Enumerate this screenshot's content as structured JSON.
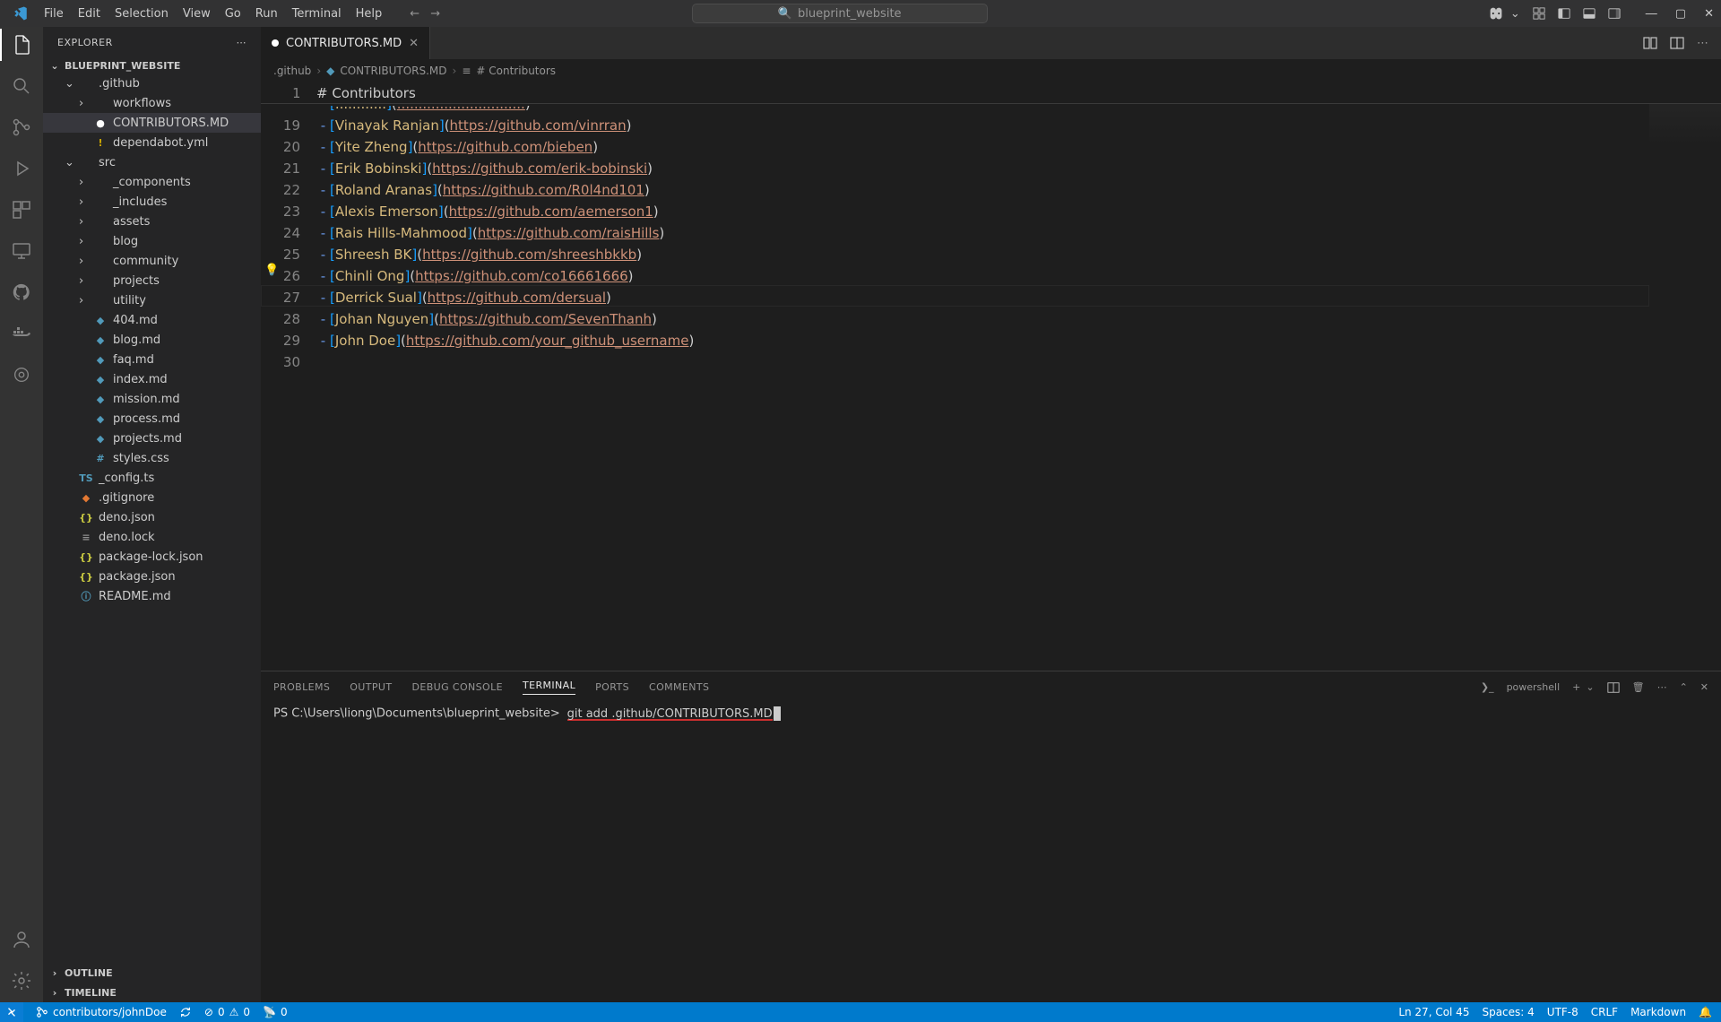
{
  "titlebar": {
    "project": "blueprint_website"
  },
  "menu": [
    "File",
    "Edit",
    "Selection",
    "View",
    "Go",
    "Run",
    "Terminal",
    "Help"
  ],
  "sidebar": {
    "title": "EXPLORER",
    "root": "BLUEPRINT_WEBSITE",
    "items": [
      {
        "label": ".github",
        "kind": "folder",
        "indent": 1,
        "open": true
      },
      {
        "label": "workflows",
        "kind": "folder",
        "indent": 2
      },
      {
        "label": "CONTRIBUTORS.MD",
        "kind": "md",
        "indent": 2,
        "active": true,
        "mod": true
      },
      {
        "label": "dependabot.yml",
        "kind": "yaml",
        "indent": 2,
        "warn": true
      },
      {
        "label": "src",
        "kind": "folder",
        "indent": 1,
        "open": true
      },
      {
        "label": "_components",
        "kind": "folder",
        "indent": 2
      },
      {
        "label": "_includes",
        "kind": "folder",
        "indent": 2
      },
      {
        "label": "assets",
        "kind": "folder",
        "indent": 2
      },
      {
        "label": "blog",
        "kind": "folder",
        "indent": 2
      },
      {
        "label": "community",
        "kind": "folder",
        "indent": 2
      },
      {
        "label": "projects",
        "kind": "folder",
        "indent": 2
      },
      {
        "label": "utility",
        "kind": "folder",
        "indent": 2
      },
      {
        "label": "404.md",
        "kind": "md",
        "indent": 2
      },
      {
        "label": "blog.md",
        "kind": "md",
        "indent": 2
      },
      {
        "label": "faq.md",
        "kind": "md",
        "indent": 2
      },
      {
        "label": "index.md",
        "kind": "md",
        "indent": 2
      },
      {
        "label": "mission.md",
        "kind": "md",
        "indent": 2
      },
      {
        "label": "process.md",
        "kind": "md",
        "indent": 2
      },
      {
        "label": "projects.md",
        "kind": "md",
        "indent": 2
      },
      {
        "label": "styles.css",
        "kind": "css",
        "indent": 2
      },
      {
        "label": "_config.ts",
        "kind": "ts",
        "indent": 1
      },
      {
        "label": ".gitignore",
        "kind": "git",
        "indent": 1
      },
      {
        "label": "deno.json",
        "kind": "json",
        "indent": 1
      },
      {
        "label": "deno.lock",
        "kind": "lock",
        "indent": 1
      },
      {
        "label": "package-lock.json",
        "kind": "json",
        "indent": 1
      },
      {
        "label": "package.json",
        "kind": "json",
        "indent": 1
      },
      {
        "label": "README.md",
        "kind": "info",
        "indent": 1
      }
    ],
    "bottom": [
      "OUTLINE",
      "TIMELINE"
    ]
  },
  "tab": {
    "label": "CONTRIBUTORS.MD",
    "modified": true
  },
  "breadcrumbs": [
    ".github",
    "CONTRIBUTORS.MD",
    "# Contributors"
  ],
  "editor": {
    "sticky_line": 1,
    "heading": "# Contributors",
    "first_line_no": 19,
    "bulb_line": 27,
    "highlight_line": 27,
    "lines": [
      {
        "n": 19,
        "name": "Vinayak Ranjan",
        "url": "https://github.com/vinrran"
      },
      {
        "n": 20,
        "name": "Yite Zheng",
        "url": "https://github.com/bieben"
      },
      {
        "n": 21,
        "name": "Erik Bobinski",
        "url": "https://github.com/erik-bobinski"
      },
      {
        "n": 22,
        "name": "Roland Aranas",
        "url": "https://github.com/R0l4nd101"
      },
      {
        "n": 23,
        "name": "Alexis Emerson",
        "url": "https://github.com/aemerson1"
      },
      {
        "n": 24,
        "name": "Rais Hills-Mahmood",
        "url": "https://github.com/raisHills"
      },
      {
        "n": 25,
        "name": "Shreesh BK",
        "url": "https://github.com/shreeshbkkb"
      },
      {
        "n": 26,
        "name": "Chinli Ong",
        "url": "https://github.com/co16661666"
      },
      {
        "n": 27,
        "name": "Derrick Sual",
        "url": "https://github.com/dersual"
      },
      {
        "n": 28,
        "name": "Johan Nguyen",
        "url": "https://github.com/SevenThanh"
      },
      {
        "n": 29,
        "name": "John Doe",
        "url": "https://github.com/your_github_username"
      },
      {
        "n": 30,
        "empty": true
      }
    ]
  },
  "panel": {
    "tabs": [
      "PROBLEMS",
      "OUTPUT",
      "DEBUG CONSOLE",
      "TERMINAL",
      "PORTS",
      "COMMENTS"
    ],
    "active": "TERMINAL",
    "shell": "powershell",
    "prompt": "PS C:\\Users\\liong\\Documents\\blueprint_website>",
    "command": "git add .github/CONTRIBUTORS.MD"
  },
  "status": {
    "branch": "contributors/johnDoe",
    "errors": "0",
    "warnings": "0",
    "ports": "0",
    "lncol": "Ln 27, Col 45",
    "spaces": "Spaces: 4",
    "encoding": "UTF-8",
    "eol": "CRLF",
    "lang": "Markdown"
  }
}
